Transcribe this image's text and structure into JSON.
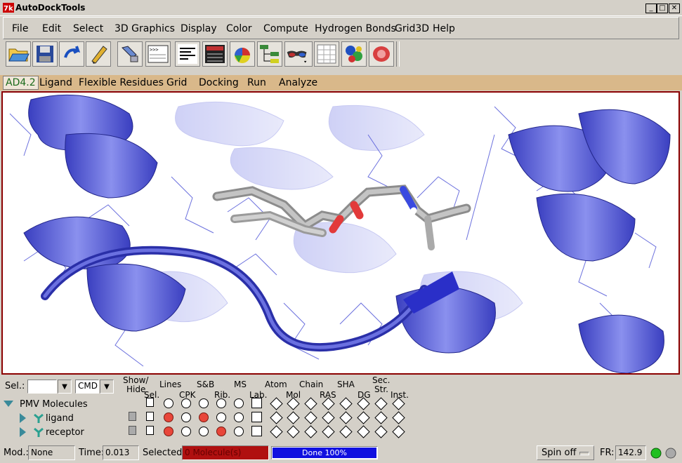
{
  "window": {
    "title": "AutoDockTools",
    "min": "_",
    "max": "□",
    "close": "✕"
  },
  "menu": [
    "File",
    "Edit",
    "Select",
    "3D Graphics",
    "Display",
    "Color",
    "Compute",
    "Hydrogen Bonds",
    "Grid3D",
    "Help"
  ],
  "toolbar_icons": [
    "open-icon",
    "save-icon",
    "undo-icon",
    "pencil-icon",
    "pick-icon",
    "command-icon",
    "lines-icon",
    "console-icon",
    "colors-icon",
    "tree-icon",
    "glasses-icon",
    "spreadsheet-icon",
    "molecule-icon",
    "surface-icon"
  ],
  "ad_menu": {
    "active": "AD4.2",
    "items": [
      "Ligand",
      "Flexible Residues",
      "Grid",
      "Docking",
      "Run",
      "Analyze"
    ]
  },
  "dashboard": {
    "sel_label": "Sel.:",
    "sel_value": "",
    "cmd_value": "CMD",
    "headers_top": [
      "Show/",
      "Lines",
      "S&B",
      "MS",
      "Atom",
      "Chain",
      "SHA",
      "Sec."
    ],
    "headers_bottom": [
      "Hide",
      "Sel.",
      "CPK",
      "Rib.",
      "Lab.",
      "Mol",
      "RAS",
      "DG",
      "Str.",
      "Inst."
    ],
    "tree_root": "PMV Molecules",
    "molecules": [
      {
        "name": "ligand",
        "lines": true,
        "sb": true,
        "rib": false
      },
      {
        "name": "receptor",
        "lines": true,
        "sb": false,
        "rib": true
      }
    ]
  },
  "status": {
    "mod_label": "Mod.:",
    "mod_value": "None",
    "time_label": "Time:",
    "time_value": "0.013",
    "selected_label": "Selected:",
    "selected_value": "0 Molecule(s)",
    "progress_text": "Done 100%",
    "progress": 1.0,
    "spin_value": "Spin off",
    "fr_label": "FR:",
    "fr_value": "142.9"
  },
  "colors": {
    "viewer_border": "#8b0000",
    "ribbon": "#5a5fd8",
    "ad_bar": "#d9b88a",
    "progress": "#1010e0",
    "selected_bg": "#b01010"
  }
}
